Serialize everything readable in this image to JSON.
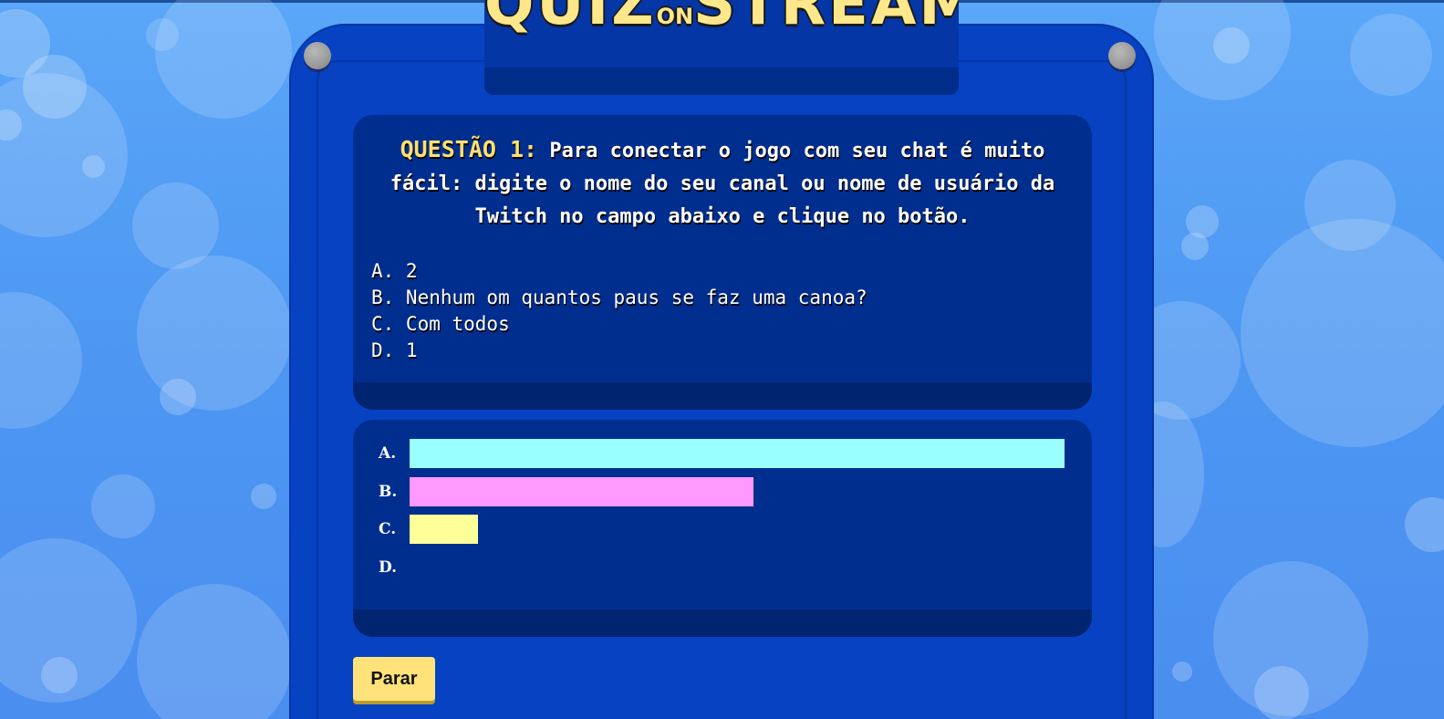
{
  "logo": {
    "part1": "QUIZ",
    "part_on": "ON",
    "part2": "STREAM"
  },
  "question": {
    "label": "QUESTÃO 1:",
    "text": "Para conectar o jogo com seu chat é muito fácil: digite o nome do seu canal ou nome de usuário da Twitch no campo abaixo e clique no botão.",
    "options": [
      "A. 2",
      "B. Nenhum om quantos paus se faz uma canoa?",
      "C. Com todos",
      "D. 1"
    ]
  },
  "results": [
    {
      "label": "A.",
      "share": 1.0,
      "color": "#99ffff"
    },
    {
      "label": "B.",
      "share": 0.525,
      "color": "#ff99ff"
    },
    {
      "label": "C.",
      "share": 0.105,
      "color": "#ffff99"
    },
    {
      "label": "D.",
      "share": 0.0,
      "color": "#cccccc"
    }
  ],
  "controls": {
    "stop_label": "Parar"
  },
  "colors": {
    "background": "#5aa6f8",
    "board": "#0642c2",
    "panel": "#002e8f",
    "accent_yellow": "#ffe27a"
  }
}
